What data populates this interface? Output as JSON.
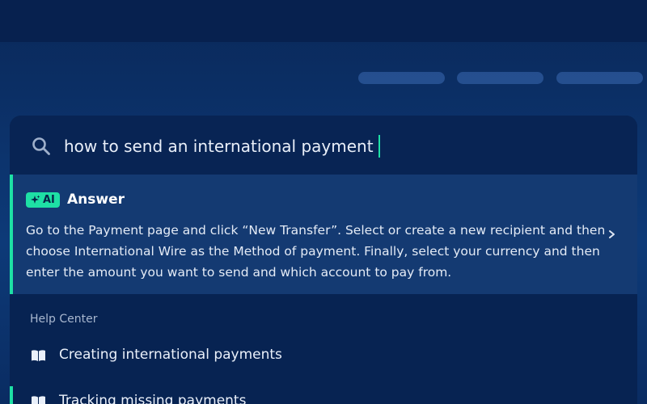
{
  "search": {
    "query": "how to send an international payment",
    "icon": "search-icon"
  },
  "answer": {
    "badge": "AI",
    "title": "Answer",
    "body": "Go to the Payment page and click “New Transfer”. Select or create a new recipient and then choose International Wire as the Method of payment. Finally, select your currency and then enter the amount you want to send and which account to pay from.",
    "accent_color": "#1ee0a5"
  },
  "help_center": {
    "label": "Help Center",
    "items": [
      {
        "label": "Creating international payments",
        "icon": "book-icon"
      },
      {
        "label": "Tracking missing payments",
        "icon": "book-icon"
      }
    ]
  }
}
